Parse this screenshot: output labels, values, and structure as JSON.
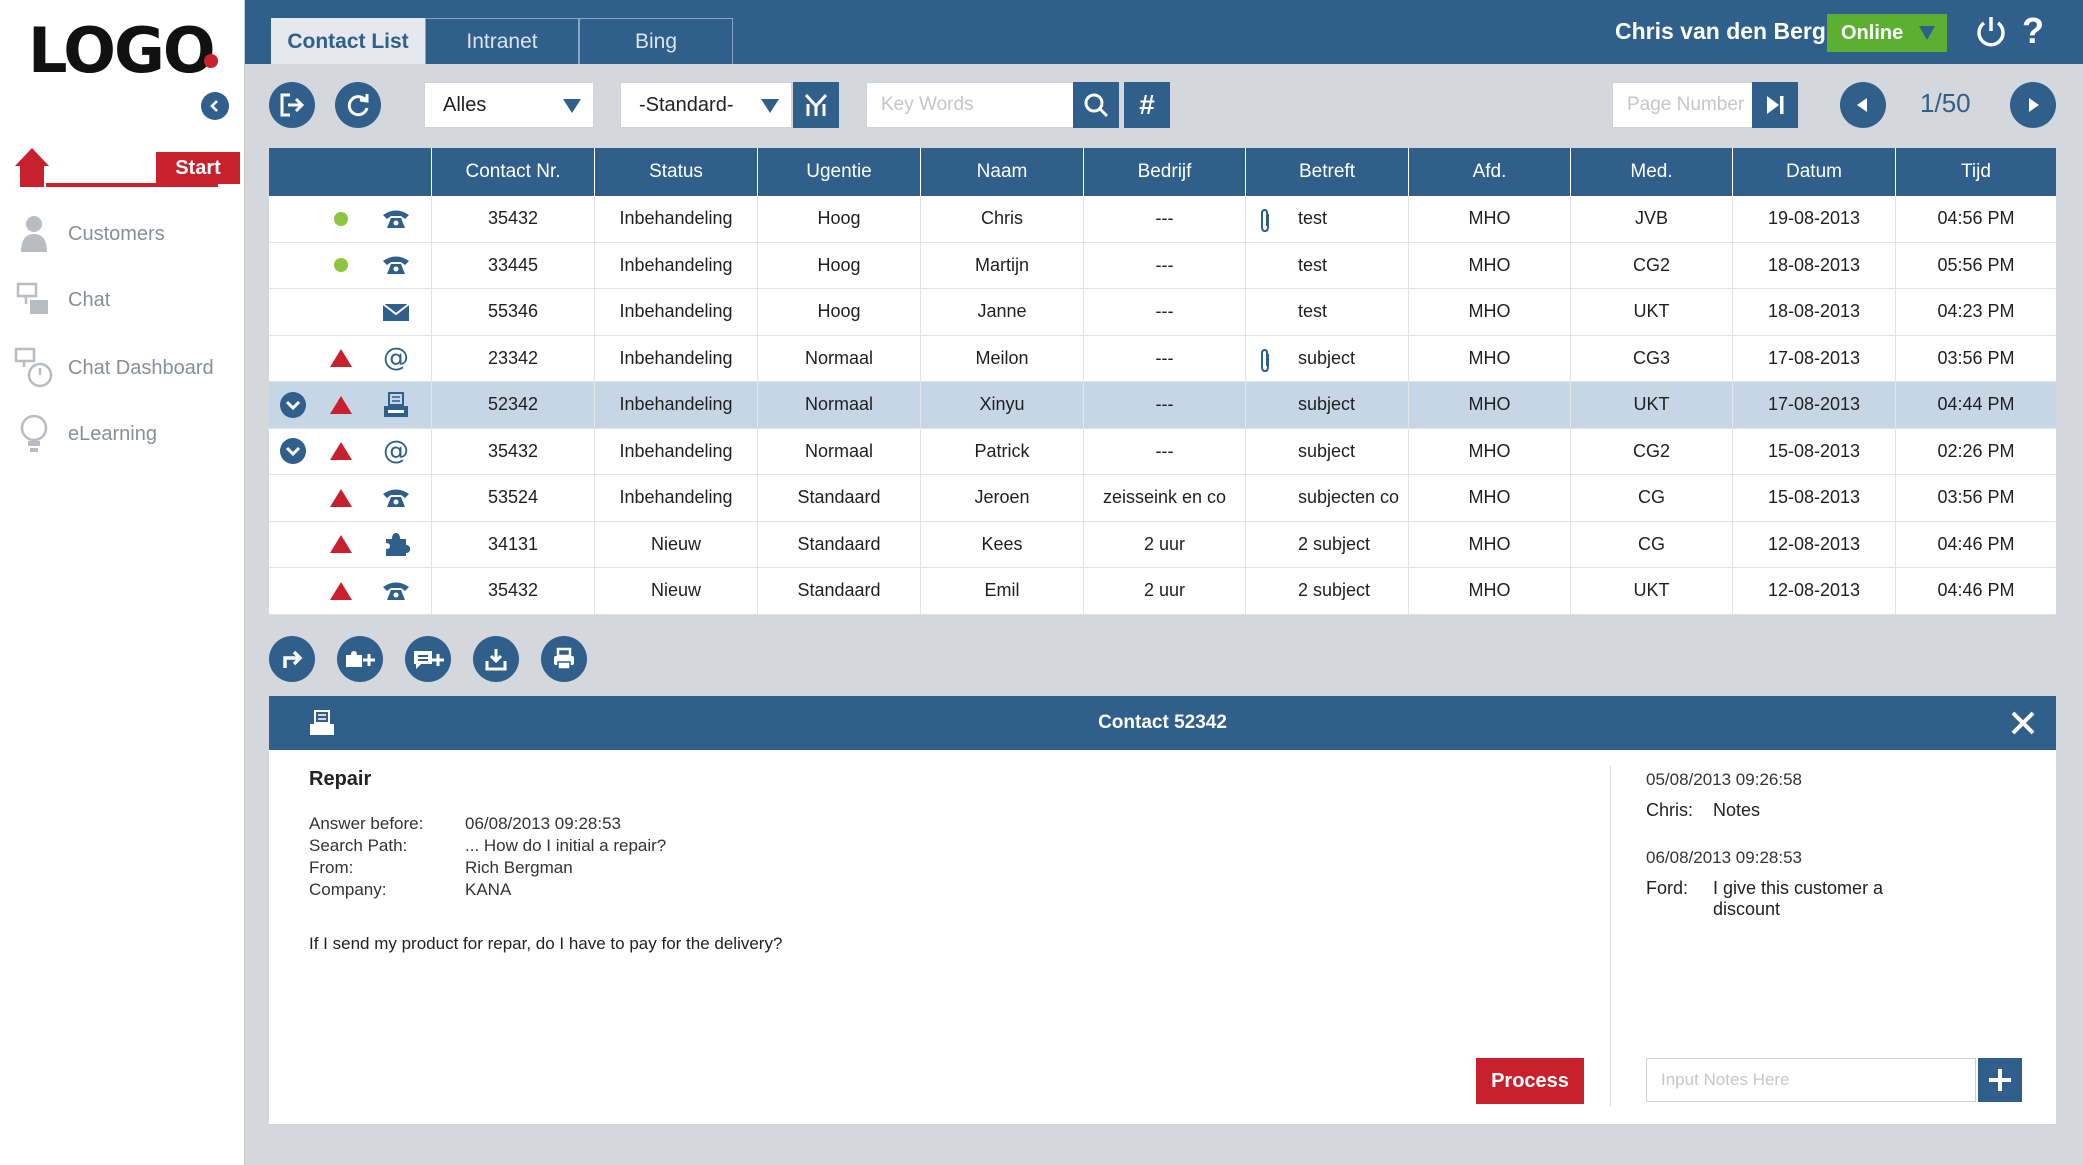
{
  "logo": "LOGO",
  "sidebar": {
    "start_label": "Start",
    "items": [
      {
        "label": "Customers",
        "icon": "person-icon"
      },
      {
        "label": "Chat",
        "icon": "chat-icon"
      },
      {
        "label": "Chat Dashboard",
        "icon": "chat-dashboard-icon"
      },
      {
        "label": "eLearning",
        "icon": "lightbulb-icon"
      }
    ]
  },
  "tabs": [
    {
      "label": "Contact List",
      "active": true
    },
    {
      "label": "Intranet",
      "active": false
    },
    {
      "label": "Bing",
      "active": false
    }
  ],
  "user": {
    "name": "Chris van den Berg",
    "status": "Online"
  },
  "toolbar": {
    "filter_value": "Alles",
    "view_value": "-Standard-",
    "search_placeholder": "Key Words",
    "page_placeholder": "Page Number",
    "page_current": "1",
    "page_total": "/50"
  },
  "table": {
    "headers": [
      "Contact Nr.",
      "Status",
      "Ugentie",
      "Naam",
      "Bedrijf",
      "Betreft",
      "Afd.",
      "Med.",
      "Datum",
      "Tijd"
    ],
    "rows": [
      {
        "expand": false,
        "indicator": "green",
        "type": "phone",
        "clip": true,
        "nr": "35432",
        "status": "Inbehandeling",
        "urgency": "Hoog",
        "name": "Chris",
        "company": "---",
        "subject": "test",
        "dept": "MHO",
        "med": "JVB",
        "date": "19-08-2013",
        "time": "04:56 PM",
        "selected": false
      },
      {
        "expand": false,
        "indicator": "green",
        "type": "phone",
        "clip": false,
        "nr": "33445",
        "status": "Inbehandeling",
        "urgency": "Hoog",
        "name": "Martijn",
        "company": "---",
        "subject": "test",
        "dept": "MHO",
        "med": "CG2",
        "date": "18-08-2013",
        "time": "05:56 PM",
        "selected": false
      },
      {
        "expand": false,
        "indicator": "none",
        "type": "mail",
        "clip": false,
        "nr": "55346",
        "status": "Inbehandeling",
        "urgency": "Hoog",
        "name": "Janne",
        "company": "---",
        "subject": "test",
        "dept": "MHO",
        "med": "UKT",
        "date": "18-08-2013",
        "time": "04:23 PM",
        "selected": false
      },
      {
        "expand": false,
        "indicator": "red",
        "type": "at",
        "clip": true,
        "nr": "23342",
        "status": "Inbehandeling",
        "urgency": "Normaal",
        "name": "Meilon",
        "company": "---",
        "subject": "subject",
        "dept": "MHO",
        "med": "CG3",
        "date": "17-08-2013",
        "time": "03:56 PM",
        "selected": false
      },
      {
        "expand": true,
        "indicator": "red",
        "type": "printer",
        "clip": false,
        "nr": "52342",
        "status": "Inbehandeling",
        "urgency": "Normaal",
        "name": "Xinyu",
        "company": "---",
        "subject": "subject",
        "dept": "MHO",
        "med": "UKT",
        "date": "17-08-2013",
        "time": "04:44 PM",
        "selected": true
      },
      {
        "expand": true,
        "indicator": "red",
        "type": "at",
        "clip": false,
        "nr": "35432",
        "status": "Inbehandeling",
        "urgency": "Normaal",
        "name": "Patrick",
        "company": "---",
        "subject": "subject",
        "dept": "MHO",
        "med": "CG2",
        "date": "15-08-2013",
        "time": "02:26 PM",
        "selected": false
      },
      {
        "expand": false,
        "indicator": "red",
        "type": "phone",
        "clip": false,
        "nr": "53524",
        "status": "Inbehandeling",
        "urgency": "Standaard",
        "name": "Jeroen",
        "company": "zeisseink en co",
        "subject": "subjecten co",
        "dept": "MHO",
        "med": "CG",
        "date": "15-08-2013",
        "time": "03:56 PM",
        "selected": false
      },
      {
        "expand": false,
        "indicator": "red",
        "type": "puzzle",
        "clip": false,
        "nr": "34131",
        "status": "Nieuw",
        "urgency": "Standaard",
        "name": "Kees",
        "company": "2 uur",
        "subject": "2 subject",
        "dept": "MHO",
        "med": "CG",
        "date": "12-08-2013",
        "time": "04:46 PM",
        "selected": false
      },
      {
        "expand": false,
        "indicator": "red",
        "type": "phone",
        "clip": false,
        "nr": "35432",
        "status": "Nieuw",
        "urgency": "Standaard",
        "name": "Emil",
        "company": "2 uur",
        "subject": "2 subject",
        "dept": "MHO",
        "med": "UKT",
        "date": "12-08-2013",
        "time": "04:46 PM",
        "selected": false
      }
    ]
  },
  "detail": {
    "title": "Contact 52342",
    "subject": "Repair",
    "meta": [
      {
        "label": "Answer before:",
        "value": "06/08/2013   09:28:53"
      },
      {
        "label": "Search Path:",
        "value": "... How do I initial a repair?"
      },
      {
        "label": "From:",
        "value": "Rich Bergman"
      },
      {
        "label": "Company:",
        "value": "KANA"
      }
    ],
    "question": "If I send my product for repar, do I have to pay for the delivery?",
    "process_label": "Process",
    "notes": [
      {
        "time": "05/08/2013   09:26:58",
        "author": "Chris:",
        "text": "Notes"
      },
      {
        "time": "06/08/2013   09:28:53",
        "author": "Ford:",
        "text": "I give this customer a discount"
      }
    ],
    "notes_placeholder": "Input Notes Here"
  },
  "colors": {
    "primary": "#2f5f8a",
    "accent": "#c8202c",
    "online": "#5cb031",
    "selected_row": "#c6d6e5"
  }
}
